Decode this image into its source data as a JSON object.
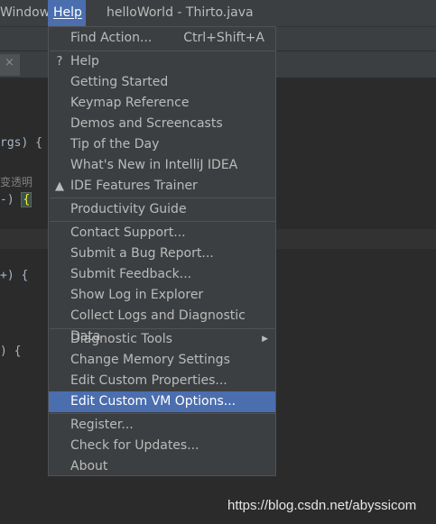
{
  "menubar": {
    "window_label": "Window",
    "help_label": "Help",
    "title": "helloWorld - Thirto.java"
  },
  "editor": {
    "tab_close": "×",
    "lines": [
      "rgs) {",
      "变透明",
      "-) ",
      "{",
      "+) {",
      ") {"
    ]
  },
  "help_menu": {
    "find_action": "Find Action...",
    "find_action_shortcut": "Ctrl+Shift+A",
    "help": "Help",
    "getting_started": "Getting Started",
    "keymap_reference": "Keymap Reference",
    "demos": "Demos and Screencasts",
    "tip_of_day": "Tip of the Day",
    "whats_new": "What's New in IntelliJ IDEA",
    "ide_trainer": "IDE Features Trainer",
    "productivity_guide": "Productivity Guide",
    "contact_support": "Contact Support...",
    "submit_bug": "Submit a Bug Report...",
    "submit_feedback": "Submit Feedback...",
    "show_log": "Show Log in Explorer",
    "collect_logs": "Collect Logs and Diagnostic Data",
    "diagnostic_tools": "Diagnostic Tools",
    "change_memory": "Change Memory Settings",
    "edit_properties": "Edit Custom Properties...",
    "edit_vm_options": "Edit Custom VM Options...",
    "register": "Register...",
    "check_updates": "Check for Updates...",
    "about": "About"
  },
  "watermark": "https://blog.csdn.net/abyssicom",
  "colors": {
    "menu_bg": "#3c3f41",
    "selection": "#4b6eaf",
    "editor_bg": "#2b2b2b"
  }
}
